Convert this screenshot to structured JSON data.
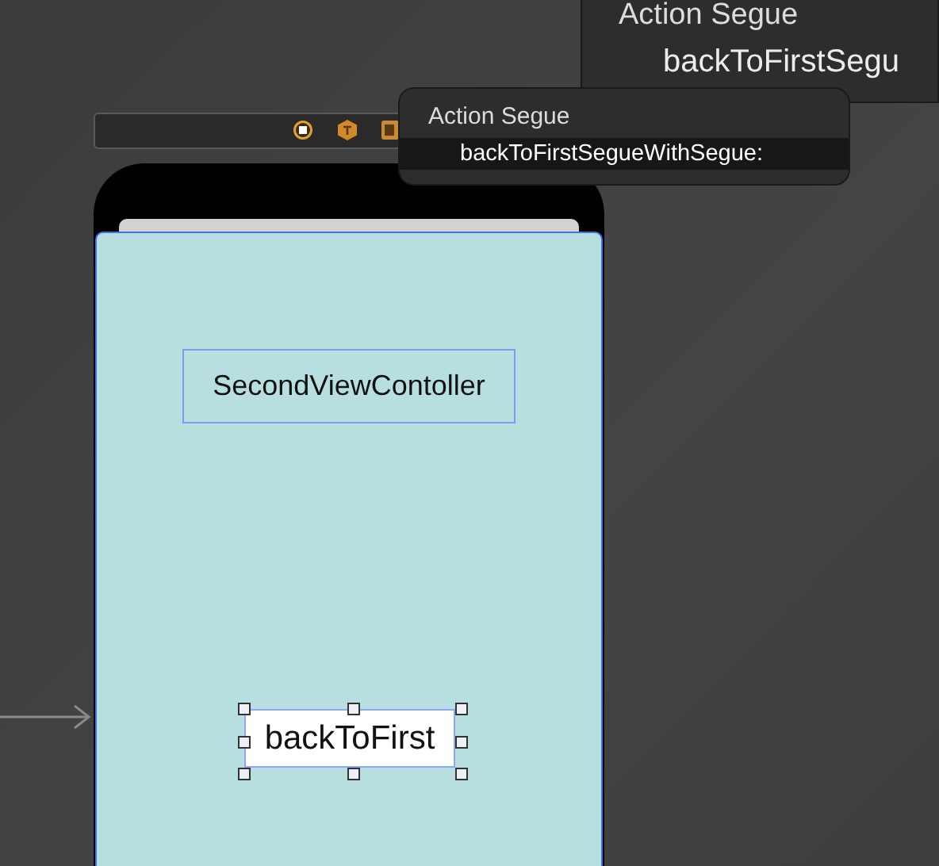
{
  "popups": [
    {
      "title": "Action Segue",
      "items": [
        {
          "label": "backToFirstSegu",
          "selected": false
        }
      ]
    },
    {
      "title": "Action Segue",
      "items": [
        {
          "label": "backToFirstSegueWithSegue:",
          "selected": true
        }
      ]
    }
  ],
  "scene": {
    "label": "SecondViewContoller",
    "button": {
      "label": "backToFirst",
      "selected": true
    }
  }
}
